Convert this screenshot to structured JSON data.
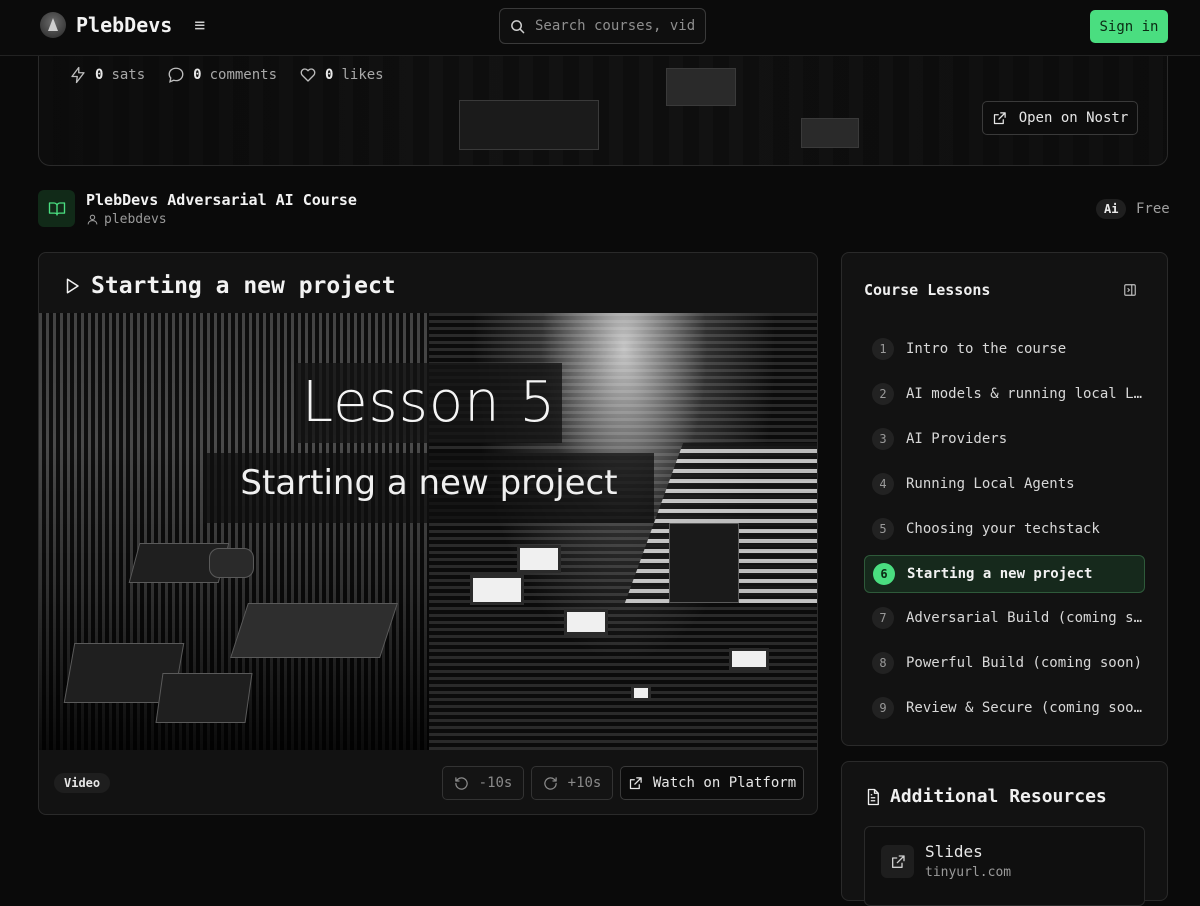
{
  "header": {
    "brand": "PlebDevs",
    "search_placeholder": "Search courses, vide",
    "signin_label": "Sign in"
  },
  "hero": {
    "stats": [
      {
        "icon": "zap-icon",
        "value": "0",
        "unit": "sats"
      },
      {
        "icon": "comment-icon",
        "value": "0",
        "unit": "comments"
      },
      {
        "icon": "heart-icon",
        "value": "0",
        "unit": "likes"
      }
    ],
    "open_nostr_label": "Open on Nostr"
  },
  "course": {
    "title": "PlebDevs Adversarial AI Course",
    "author": "plebdevs",
    "tag": "Ai",
    "price": "Free"
  },
  "video": {
    "title": "Starting a new project",
    "thumbnail_heading": "Lesson 5",
    "thumbnail_subtitle": "Starting a new project",
    "type_tag": "Video",
    "rewind_label": "-10s",
    "forward_label": "+10s",
    "watch_label": "Watch on Platform"
  },
  "lessons": {
    "title": "Course Lessons",
    "active_index": 6,
    "items": [
      {
        "num": "1",
        "label": "Intro to the course"
      },
      {
        "num": "2",
        "label": "AI models & running local LLMs"
      },
      {
        "num": "3",
        "label": "AI Providers"
      },
      {
        "num": "4",
        "label": "Running Local Agents"
      },
      {
        "num": "5",
        "label": "Choosing your techstack"
      },
      {
        "num": "6",
        "label": "Starting a new project"
      },
      {
        "num": "7",
        "label": "Adversarial Build (coming soon)"
      },
      {
        "num": "8",
        "label": "Powerful Build (coming soon)"
      },
      {
        "num": "9",
        "label": "Review & Secure (coming soon)"
      }
    ]
  },
  "resources": {
    "title": "Additional Resources",
    "items": [
      {
        "name": "Slides",
        "url": "tinyurl.com"
      }
    ]
  },
  "colors": {
    "accent": "#4ade80",
    "background": "#0a0a0a",
    "card": "#121212",
    "border": "#2a2a2a"
  }
}
